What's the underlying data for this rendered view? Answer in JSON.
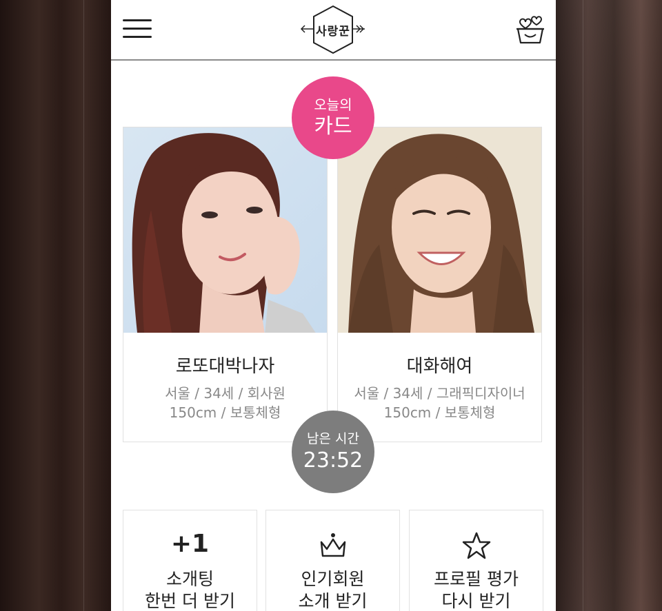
{
  "header": {
    "menu_icon": "hamburger-icon",
    "logo_text": "사랑꾼",
    "cart_icon": "heart-basket-icon"
  },
  "today_badge": {
    "line1": "오늘의",
    "line2": "카드"
  },
  "cards": [
    {
      "name": "로또대박나자",
      "info_line1": "서울 / 34세 / 회사원",
      "info_line2": "150cm / 보통체형"
    },
    {
      "name": "대화해여",
      "info_line1": "서울 / 34세 / 그래픽디자이너",
      "info_line2": "150cm / 보통체형"
    }
  ],
  "timer_badge": {
    "label": "남은 시간",
    "time": "23:52"
  },
  "actions": [
    {
      "top": "+1",
      "line1": "소개팅",
      "line2": "한번 더 받기"
    },
    {
      "icon": "crown-icon",
      "line1": "인기회원",
      "line2": "소개 받기"
    },
    {
      "icon": "star-icon",
      "line1": "프로필 평가",
      "line2": "다시 받기"
    }
  ],
  "colors": {
    "accent_pink": "#e9488a",
    "timer_gray": "#7d7d7d"
  }
}
